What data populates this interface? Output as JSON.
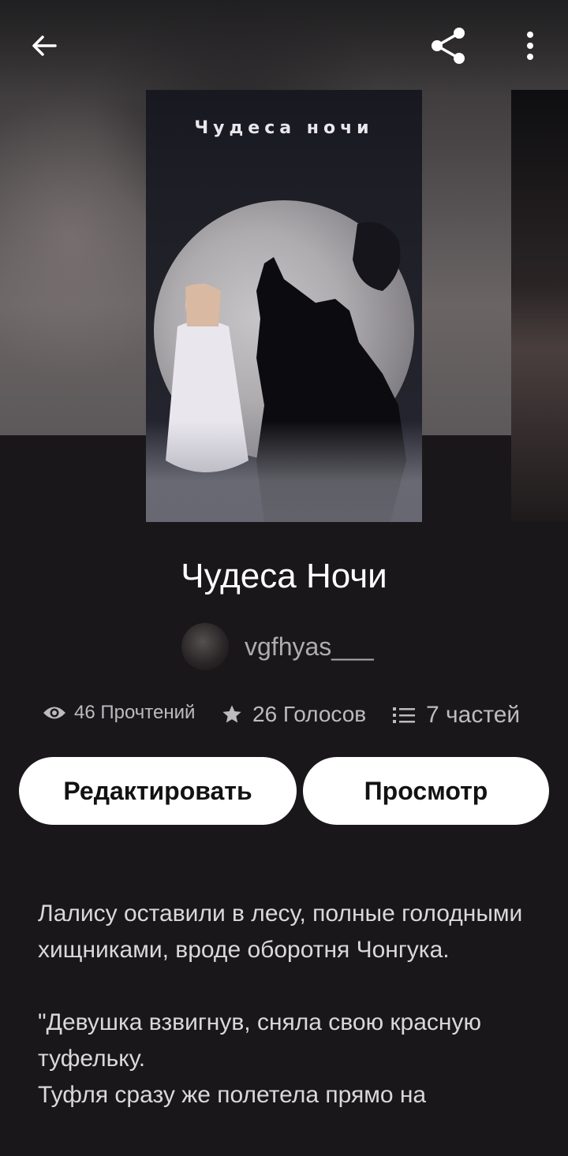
{
  "header": {
    "back_icon": "arrow-left-icon",
    "share_icon": "share-icon",
    "more_icon": "more-vertical-icon"
  },
  "cover": {
    "text": "Чудеса ночи"
  },
  "story": {
    "title": "Чудеса Ночи",
    "author": "vgfhyas___"
  },
  "stats": {
    "reads": "46 Прочтений",
    "votes": "26 Голосов",
    "parts": "7 частей"
  },
  "buttons": {
    "edit": "Редактировать",
    "view": "Просмотр"
  },
  "description": {
    "paragraph1": "Лалису оставили в лесу, полные голодными хищниками, вроде оборотня Чонгука.",
    "paragraph2_line1": "\"Девушка взвигнув, сняла свою красную туфельку.",
    "paragraph2_line2": "Туфля сразу же полетела прямо на"
  }
}
